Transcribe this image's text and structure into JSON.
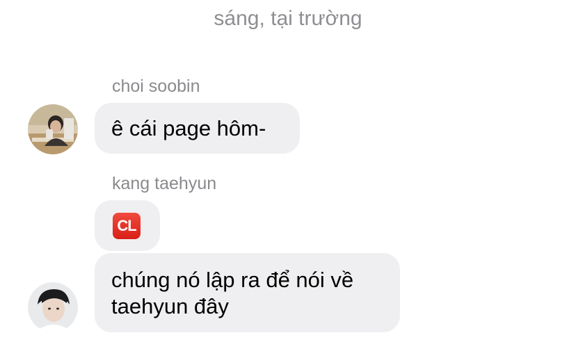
{
  "chat": {
    "header_text": "sáng, tại trường",
    "messages": [
      {
        "sender": "choi soobin",
        "text": "ê cái page hôm-"
      },
      {
        "sender": "kang taehyun",
        "emoji_label": "CL",
        "emoji_color": "#e32b22",
        "text": "chúng nó lập ra để nói về taehyun đây"
      }
    ]
  },
  "avatars": {
    "soobin_icon": "avatar-photo-icon",
    "taehyun_icon": "avatar-photo-icon"
  }
}
